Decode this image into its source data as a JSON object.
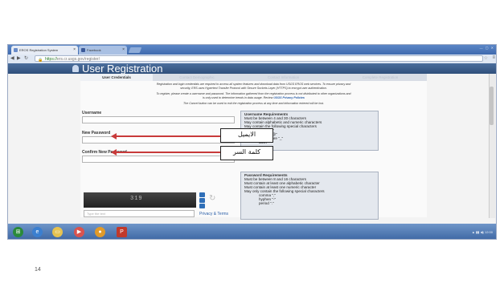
{
  "slide": {
    "page_number": "14"
  },
  "browser": {
    "tabs": [
      {
        "label": "EROS Registration System",
        "active": true
      },
      {
        "label": "Facebook",
        "active": false
      }
    ],
    "address": {
      "protocol": "https://",
      "host": "ers.cr.usgs.gov",
      "path": "/register/"
    }
  },
  "page": {
    "title": "User Registration",
    "steps": [
      "User Credentials",
      "Contact Demographic",
      "Contact Information",
      "Complete Registration"
    ],
    "active_step": 0,
    "intro": {
      "line1": "Registration and login credentials are required to access all system features and download data from USGS EROS web services. To ensure privacy and",
      "line2": "security, ERS uses Hypertext Transfer Protocol with Secure Sockets Layer (HTTPS) to encrypt user authentication.",
      "line3": "To register, please create a username and password. The information gathered from the registration process is not distributed to other organizations and",
      "line4": "is only used to determine trends in data usage. Review",
      "privacy_link": "USGS Privacy Policies",
      "line5": "The Cancel button can be used to exit the registration process at any time and information entered will be lost."
    },
    "fields": {
      "username_label": "Username",
      "new_password_label": "New Password",
      "confirm_password_label": "Confirm New Password"
    },
    "username_requirements": {
      "title": "Username Requirements",
      "items": [
        "Must be between 4 and 30 characters",
        "May contain alphabetic and numeric characters",
        "May contain the following special characters",
        "period \".\"",
        "at sign \"@\"",
        "underscore \"_\"",
        "dash \"-\""
      ]
    },
    "password_requirements": {
      "title": "Password Requirements",
      "items": [
        "Must be between 8 and 16 characters",
        "Must contain at least one alphabetic character",
        "Must contain at least one numeric character",
        "May only contain the following special characters",
        "comma \",\"",
        "hyphen \"-\"",
        "period \".\""
      ]
    },
    "captcha": {
      "image_text": "319",
      "input_placeholder": "Type the text",
      "privacy_link": "Privacy & Terms"
    }
  },
  "annotations": {
    "username_callout": "الايميل",
    "password_callout": "كلمة السر"
  },
  "colors": {
    "header": "#3a5d8f",
    "arrow": "#c83a3a",
    "taskbar": "#4f78b5"
  }
}
